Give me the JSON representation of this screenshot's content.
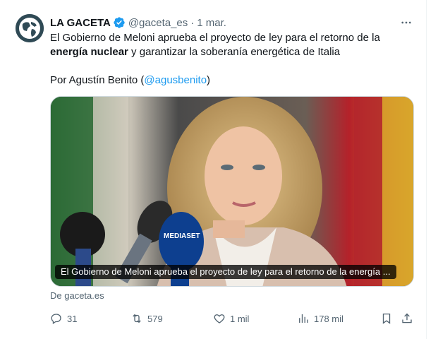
{
  "account": {
    "name": "LA GACETA",
    "handle": "@gaceta_es",
    "separator": "·",
    "date": "1 mar."
  },
  "tweet": {
    "text_part1": "El Gobierno de Meloni aprueba el proyecto de ley para el retorno de la ",
    "text_bold": "energía nuclear",
    "text_part2": " y garantizar la soberanía energética de Italia",
    "byline_prefix": "Por Agustín Benito (",
    "byline_mention": "@agusbenito",
    "byline_suffix": ")"
  },
  "media": {
    "caption": "El Gobierno de Meloni aprueba el proyecto de ley para el retorno de la energía ...",
    "mic_label": "MEDIASET"
  },
  "link_source": "De gaceta.es",
  "actions": {
    "replies": "31",
    "reposts": "579",
    "likes": "1 mil",
    "views": "178 mil"
  },
  "icons": {
    "more": "more-icon",
    "verified": "verified-badge-icon",
    "reply": "reply-icon",
    "repost": "repost-icon",
    "like": "heart-icon",
    "views": "views-chart-icon",
    "bookmark": "bookmark-icon",
    "share": "share-icon"
  },
  "colors": {
    "verified": "#1d9bf0",
    "link": "#1d9bf0",
    "muted": "#536471",
    "text": "#0f1419"
  }
}
